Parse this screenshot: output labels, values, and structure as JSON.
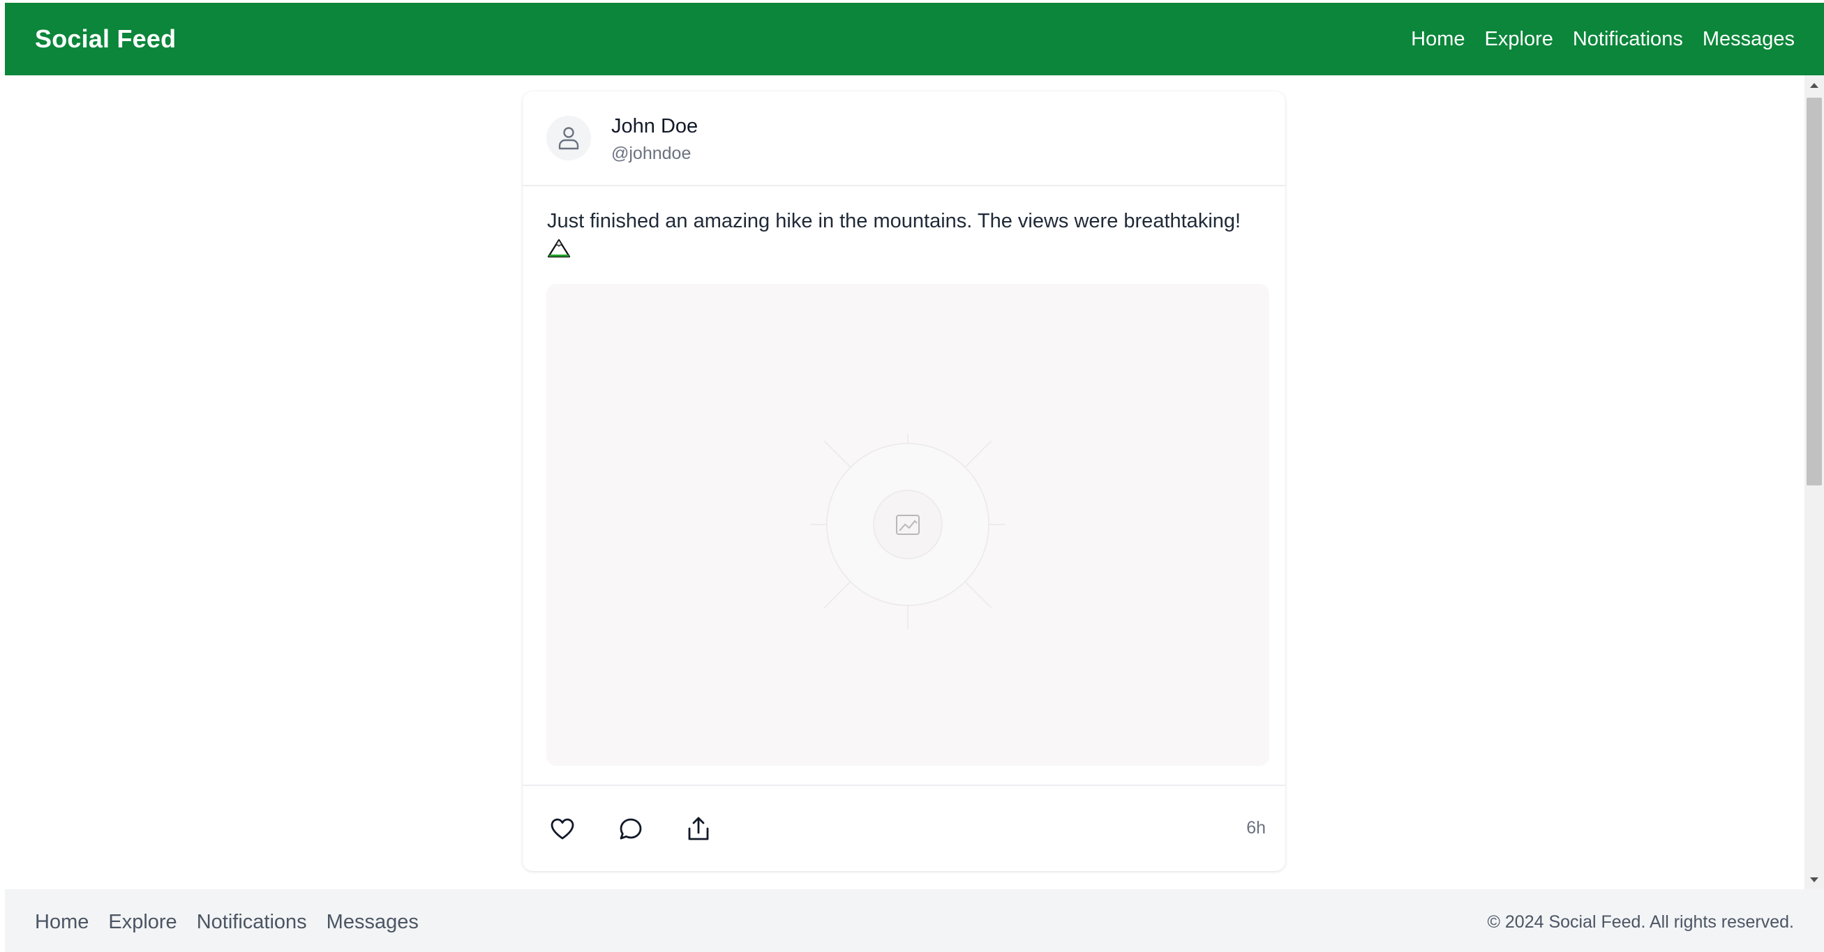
{
  "header": {
    "brand": "Social Feed",
    "nav": [
      "Home",
      "Explore",
      "Notifications",
      "Messages"
    ]
  },
  "post": {
    "author_name": "John Doe",
    "author_handle": "@johndoe",
    "text": "Just finished an amazing hike in the mountains. The views were breathtaking!",
    "emoji_icon": "mountain-icon",
    "media_placeholder_icon": "image-icon",
    "actions": [
      "heart-icon",
      "comment-icon",
      "share-icon"
    ],
    "timestamp": "6h"
  },
  "footer": {
    "nav": [
      "Home",
      "Explore",
      "Notifications",
      "Messages"
    ],
    "copyright": "© 2024 Social Feed. All rights reserved."
  },
  "colors": {
    "brand": "#0b863a",
    "footer_bg": "#f3f4f6",
    "muted_text": "#6b7280"
  }
}
